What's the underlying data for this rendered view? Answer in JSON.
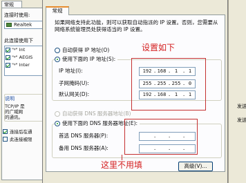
{
  "background_window": {
    "tab_label": "常规",
    "connect_using_label": "连接时使用:",
    "device_name": "Realtek",
    "items_label": "此连接使用下",
    "items": [
      "\"ᵍ\" Int",
      "\"ᵍ\" AEGIS",
      "\"ᵍ\" Inter"
    ],
    "description_heading": "说明",
    "description_text": "TCP/IP 是\n的广域网\n的通讯。",
    "checkbox_1": "连接后在通",
    "checkbox_2": "此连接被限",
    "right_strip_text_1": "发送",
    "right_strip_text_2": "发送"
  },
  "dialog": {
    "tab_label": "常规",
    "description": "如果网络支持此功能，则可以获取自动指派的 IP 设置。否则，您需要从网络系统管理员处获得适当的 IP 设置。",
    "auto_ip_label": "自动获得 IP 地址(O)",
    "manual_ip_label": "使用下面的 IP 地址(S):",
    "ip_address_label": "IP 地址(I):",
    "subnet_mask_label": "子网掩码(U):",
    "gateway_label": "默认网关(D):",
    "ip_address": [
      "192",
      "168",
      "1",
      "1"
    ],
    "subnet_mask": [
      "255",
      "255",
      "255",
      "0"
    ],
    "gateway": [
      "192",
      "168",
      "1",
      "1"
    ],
    "auto_dns_label": "自动获得 DNS 服务器地址(B)",
    "manual_dns_label": "使用下面的 DNS 服务器地址(E):",
    "preferred_dns_label": "首选 DNS 服务器(P):",
    "alternate_dns_label": "备用 DNS 服务器(A):",
    "advanced_button": "高级(V)...",
    "selected_ip_mode": "manual",
    "selected_dns_mode": "manual"
  },
  "annotations": {
    "settings_note": "设置如下",
    "no_fill_note": "这里不用填",
    "color": "#d42020"
  }
}
